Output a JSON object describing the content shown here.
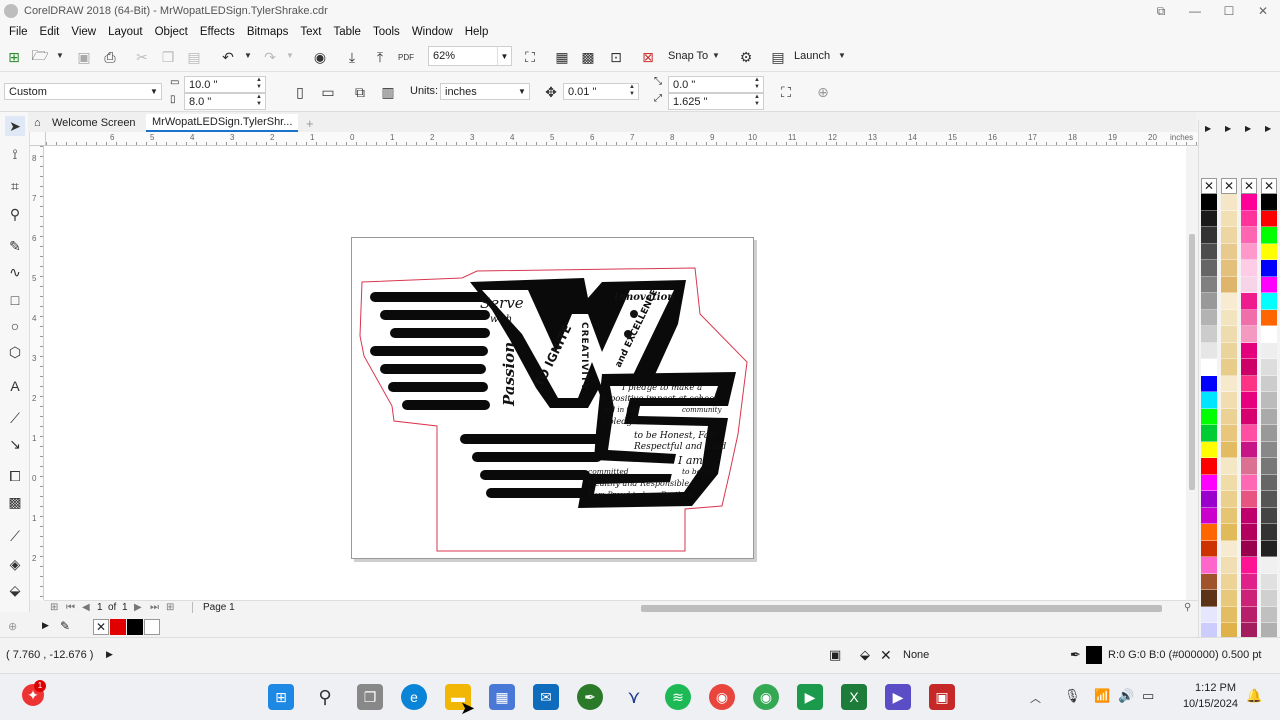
{
  "window": {
    "title": "CorelDRAW 2018 (64-Bit) - MrWopatLEDSign.TylerShrake.cdr"
  },
  "menu": [
    "File",
    "Edit",
    "View",
    "Layout",
    "Object",
    "Effects",
    "Bitmaps",
    "Text",
    "Table",
    "Tools",
    "Window",
    "Help"
  ],
  "toolbar": {
    "zoom": "62%",
    "snap_to": "Snap To",
    "launch": "Launch",
    "pdf_label": "PDF"
  },
  "propbar": {
    "page_size": "Custom",
    "width": "10.0 \"",
    "height": "8.0 \"",
    "units_label": "Units:",
    "units_value": "inches",
    "nudge": "0.01 \"",
    "dup_x": "0.0 \"",
    "dup_y": "1.625 \""
  },
  "tabs": {
    "welcome": "Welcome Screen",
    "document": "MrWopatLEDSign.TylerShr..."
  },
  "ruler": {
    "units": "inches",
    "h_labels": [
      "7",
      "6",
      "5",
      "4",
      "3",
      "2",
      "1",
      "0",
      "1",
      "2",
      "3",
      "4",
      "5",
      "6",
      "7",
      "8",
      "9",
      "10",
      "11",
      "12",
      "13",
      "14",
      "15",
      "16",
      "17",
      "18",
      "19",
      "20"
    ],
    "v_labels": [
      "9",
      "8",
      "7",
      "6",
      "5",
      "4",
      "3",
      "2",
      "1",
      "0",
      "1",
      "2"
    ]
  },
  "artwork": {
    "serve": "Serve",
    "with": "with",
    "passion": "Passion",
    "to_ignite": "TO IGNITE",
    "creativity": "CREATIVITY",
    "innovation": "Innovation",
    "and_excellence": "and EXCELLENCE",
    "pledge_lines": [
      "I pledge to make a",
      "a positive impact at school",
      "and in the",
      "community",
      "I pledge",
      "to be Honest, Fair",
      "Respectful and Kind",
      "I am",
      "committed",
      "to being",
      "Healthy and Responsible",
      "I am Proud to be a Panther!"
    ]
  },
  "pagenav": {
    "current": "1",
    "of": "of",
    "total": "1",
    "page_tab": "Page 1"
  },
  "status": {
    "coords": "( 7.760 , -12.676 )",
    "fill": "None",
    "outline": "R:0 G:0 B:0 (#000000)  0.500 pt"
  },
  "taskbar": {
    "time": "1:12 PM",
    "date": "10/15/2024",
    "badge": "1"
  },
  "colors": {
    "accent": "#1a73c8",
    "outline_red": "#d9364f",
    "palette_col1": [
      "#000000",
      "#1a1a1a",
      "#333333",
      "#4d4d4d",
      "#666666",
      "#808080",
      "#999999",
      "#b3b3b3",
      "#cccccc",
      "#e6e6e6",
      "#ffffff",
      "#0000ff",
      "#00e5ff",
      "#00ff00",
      "#00cc33",
      "#ffff00",
      "#ff0000",
      "#ff00ff",
      "#9900cc",
      "#cc00cc",
      "#ff6600",
      "#cc3300",
      "#ff66cc",
      "#a0522d",
      "#5c3317",
      "#e6e6ff",
      "#ccccff",
      "#9999ff",
      "#6666cc",
      "#3333cc"
    ],
    "palette_col2": [
      "#f5e6c8",
      "#f2e0b5",
      "#eed6a3",
      "#e8ca8e",
      "#e3c07c",
      "#dfb56b",
      "#f7ecd2",
      "#f3e4c0",
      "#efdcae",
      "#ebd49c",
      "#e7cc8a",
      "#f6e9cc",
      "#f1ddb0",
      "#ecd195",
      "#e8c67b",
      "#e2bb63",
      "#f4e7c6",
      "#f0dca9",
      "#ebd08d",
      "#e6c572",
      "#e1ba5a",
      "#f6ead0",
      "#f1deb3",
      "#edd396",
      "#e8c87b",
      "#e3bd62",
      "#dfb24a",
      "#f5e8c9",
      "#f0dcac",
      "#ebd08f"
    ],
    "palette_col3": [
      "#ff0099",
      "#ff3399",
      "#ff66b2",
      "#ff99cc",
      "#ffcce5",
      "#f7d4e8",
      "#ee1c8c",
      "#f06eaa",
      "#f49ac1",
      "#e4007c",
      "#cc0066",
      "#ff3385",
      "#e6007e",
      "#d6006f",
      "#ff4fa3",
      "#c71585",
      "#db7093",
      "#ff69b4",
      "#e75480",
      "#c0006a",
      "#b3005e",
      "#99004d",
      "#ff1493",
      "#e0218a",
      "#cc2277",
      "#b81f6b",
      "#a31c5e",
      "#8f1852",
      "#7a1545",
      "#661138"
    ],
    "palette_col4": [
      "#000000",
      "#ff0000",
      "#00ff00",
      "#ffff00",
      "#0000ff",
      "#ff00ff",
      "#00ffff",
      "#ff6600",
      "#ffffff",
      "#eeeeee",
      "#dddddd",
      "#cccccc",
      "#bbbbbb",
      "#aaaaaa",
      "#999999",
      "#888888",
      "#777777",
      "#666666",
      "#555555",
      "#444444",
      "#333333",
      "#222222",
      "#f0f0f0",
      "#e0e0e0",
      "#d0d0d0",
      "#c0c0c0",
      "#b0b0b0",
      "#a0a0a0",
      "#909090",
      "#808080"
    ]
  }
}
